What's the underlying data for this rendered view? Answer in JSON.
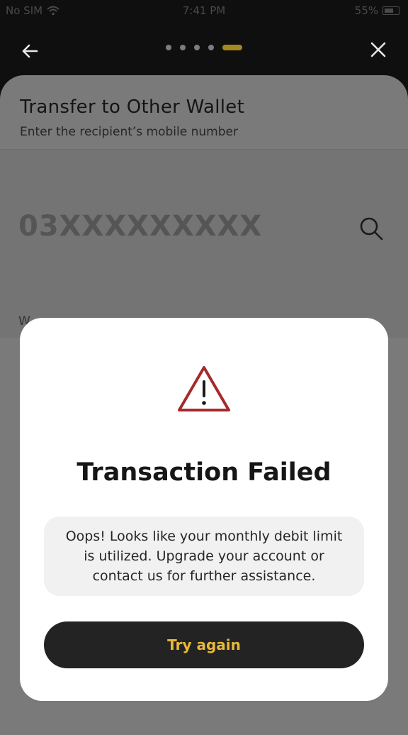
{
  "status_bar": {
    "carrier": "No SIM",
    "time": "7:41 PM",
    "battery": "55%"
  },
  "header": {
    "steps_total": 5,
    "active_step": 5
  },
  "sheet": {
    "title": "Transfer to Other Wallet",
    "subtitle": "Enter the recipient’s mobile number",
    "phone_placeholder": "03XXXXXXXXX",
    "hint_partial": "W"
  },
  "modal": {
    "title": "Transaction Failed",
    "message": "Oops! Looks like your monthly debit limit is utilized. Upgrade your account or contact us for further assistance.",
    "button_label": "Try again"
  },
  "colors": {
    "accent": "#e8b93a",
    "warning": "#a52a2a",
    "button_bg": "#232323"
  },
  "icons": {
    "back": "arrow-left-icon",
    "close": "close-icon",
    "search": "search-icon",
    "warning": "warning-triangle-icon",
    "wifi": "wifi-icon"
  }
}
